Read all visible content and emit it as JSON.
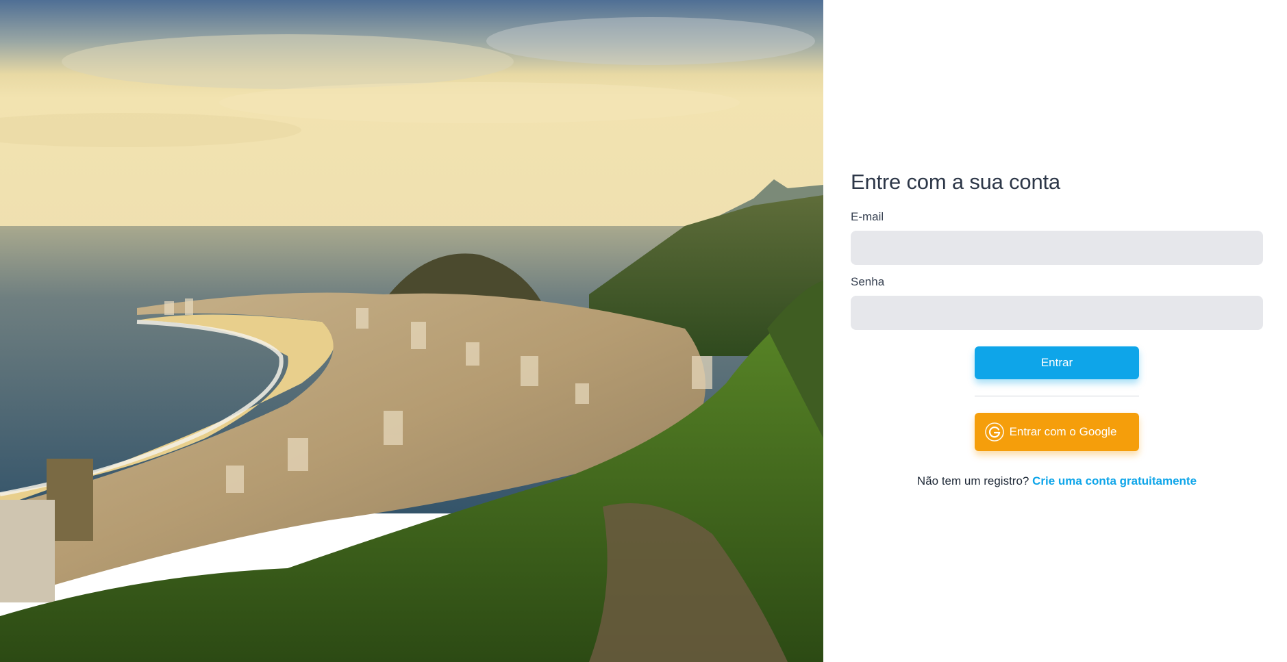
{
  "hero": {
    "image_alt": "Copacabana beach aerial view"
  },
  "form": {
    "title": "Entre com a sua conta",
    "email_label": "E-mail",
    "email_value": "",
    "password_label": "Senha",
    "password_value": "",
    "login_button": "Entrar",
    "google_button": "Entrar com o Google",
    "google_icon": "google-icon",
    "signup_prompt": "Não tem um registro?",
    "signup_link": "Crie uma conta gratuitamente"
  },
  "colors": {
    "primary": "#0ea5e9",
    "google": "#f59e0b",
    "input_bg": "#e6e7eb",
    "title": "#2d3748"
  }
}
